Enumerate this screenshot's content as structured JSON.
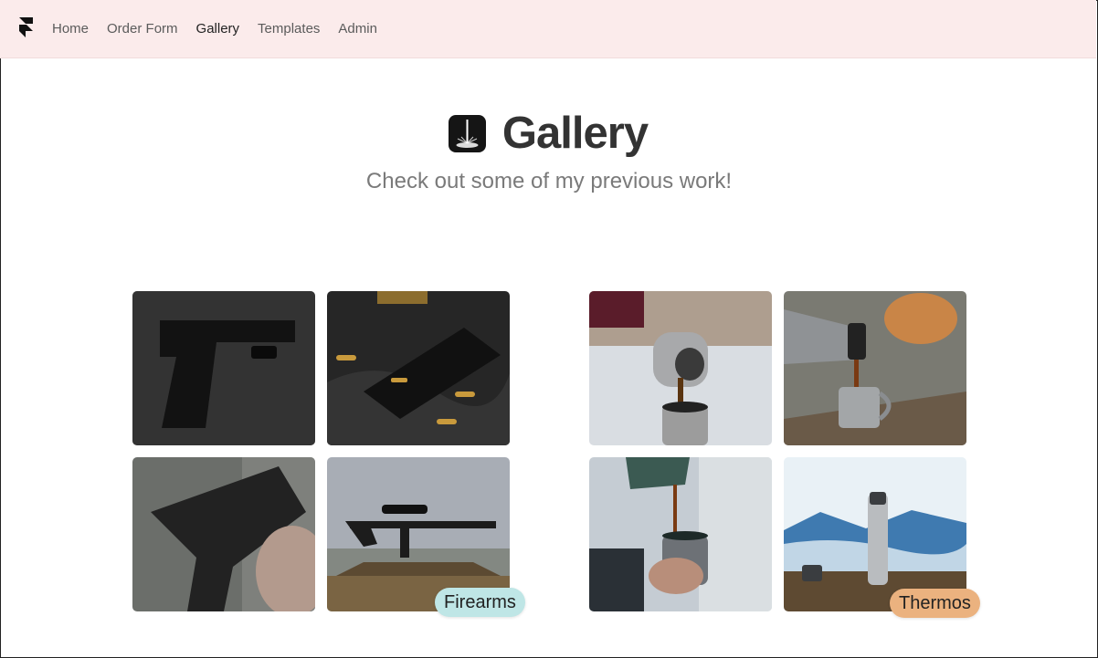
{
  "nav": {
    "items": [
      {
        "label": "Home"
      },
      {
        "label": "Order Form"
      },
      {
        "label": "Gallery"
      },
      {
        "label": "Templates"
      },
      {
        "label": "Admin"
      }
    ]
  },
  "hero": {
    "title": "Gallery",
    "subtitle": "Check out some of my previous work!"
  },
  "groups": [
    {
      "label": "Firearms",
      "color": "#bfe6e6"
    },
    {
      "label": "Thermos",
      "color": "#ebb27f"
    }
  ]
}
